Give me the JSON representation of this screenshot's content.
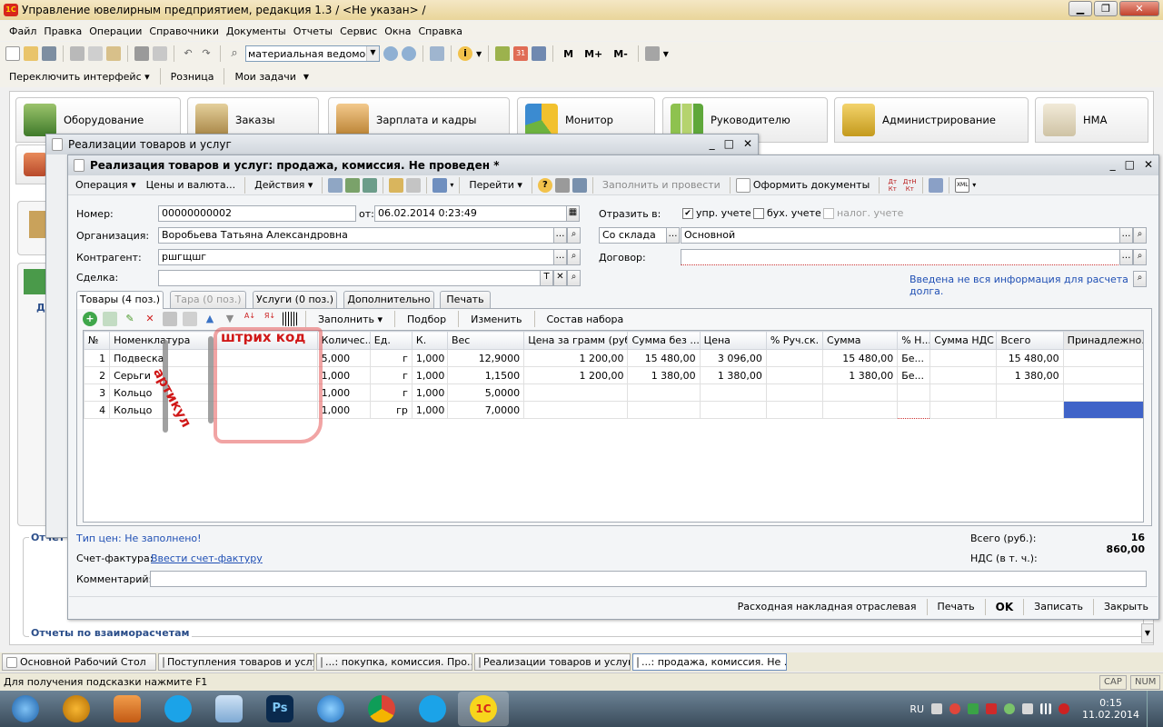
{
  "app": {
    "title": "Управление ювелирным предприятием, редакция 1.3 / <Не указан> /"
  },
  "menu": [
    "Файл",
    "Правка",
    "Операции",
    "Справочники",
    "Документы",
    "Отчеты",
    "Сервис",
    "Окна",
    "Справка"
  ],
  "toolbar": {
    "search_value": "материальная ведомость",
    "m_buttons": [
      "M",
      "M+",
      "M-"
    ]
  },
  "toolbar2": {
    "switch_label": "Переключить интерфейс",
    "retail": "Розница",
    "tasks": "Мои задачи"
  },
  "sections": [
    "Оборудование",
    "Заказы",
    "Зарплата и кадры",
    "Монитор",
    "Руководителю",
    "Администрирование",
    "НМА"
  ],
  "left_labels": {
    "do": "До",
    "otch": "Отчет",
    "reports_mutual": "Отчеты по взаиморасчетам",
    "de": "Де"
  },
  "list_window": {
    "title": "Реализации товаров и услуг"
  },
  "doc": {
    "title": "Реализация товаров и услуг: продажа, комиссия. Не проведен *",
    "toolbar": {
      "operation": "Операция",
      "prices": "Цены и валюта...",
      "actions": "Действия",
      "goto": "Перейти",
      "fill_post": "Заполнить и провести",
      "make_docs": "Оформить документы"
    },
    "number_label": "Номер:",
    "number": "00000000002",
    "from_label": "от:",
    "date": "06.02.2014  0:23:49",
    "reflect_label": "Отразить в:",
    "upr": "упр. учете",
    "buh": "бух. учете",
    "nalog": "налог. учете",
    "org_label": "Организация:",
    "org": "Воробьева Татьяна Александровна",
    "warehouse_type": "Со склада",
    "warehouse": "Основной",
    "contractor_label": "Контрагент:",
    "contractor": "ршгщшг",
    "contract_label": "Договор:",
    "deal_label": "Сделка:",
    "debt_info": "Введена не вся информация для расчета долга.",
    "tabs": [
      "Товары (4 поз.)",
      "Тара (0 поз.)",
      "Услуги (0 поз.)",
      "Дополнительно",
      "Печать"
    ],
    "table_toolbar": {
      "fill": "Заполнить",
      "pick": "Подбор",
      "change": "Изменить",
      "kit": "Состав набора"
    },
    "columns": [
      "№",
      "Номенклатура",
      "Количес...",
      "Ед.",
      "К.",
      "Вес",
      "Цена за грамм (руб.)",
      "Сумма без ...",
      "Цена",
      "% Руч.ск.",
      "Сумма",
      "% Н...",
      "Сумма НДС",
      "Всего",
      "Принадлежно..."
    ],
    "rows": [
      [
        "1",
        "Подвеска",
        "",
        "5,000",
        "г",
        "1,000",
        "12,9000",
        "1 200,00",
        "15 480,00",
        "3 096,00",
        "",
        "15 480,00",
        "Бе...",
        "",
        "15 480,00",
        ""
      ],
      [
        "2",
        "Серьги",
        "",
        "1,000",
        "г",
        "1,000",
        "1,1500",
        "1 200,00",
        "1 380,00",
        "1 380,00",
        "",
        "1 380,00",
        "Бе...",
        "",
        "1 380,00",
        ""
      ],
      [
        "3",
        "Кольцо",
        "",
        "1,000",
        "г",
        "1,000",
        "5,0000",
        "",
        "",
        "",
        "",
        "",
        "",
        "",
        "",
        ""
      ],
      [
        "4",
        "Кольцо",
        "",
        "1,000",
        "гр",
        "1,000",
        "7,0000",
        "",
        "",
        "",
        "",
        "",
        "",
        "",
        "",
        ""
      ]
    ],
    "annotations": {
      "article": "артикул",
      "barcode": "штрих код"
    },
    "price_type": "Тип цен: Не заполнено!",
    "total_label": "Всего (руб.):",
    "total": "16 860,00",
    "vat_label": "НДС (в т. ч.):",
    "invoice_label": "Счет-фактура:",
    "invoice_link": "Ввести счет-фактуру",
    "comment_label": "Комментарий:",
    "bottom_buttons": [
      "Расходная накладная отраслевая",
      "Печать",
      "OK",
      "Записать",
      "Закрыть"
    ]
  },
  "window_tabs": [
    "Основной Рабочий Стол",
    "Поступления товаров и услуг",
    "...: покупка, комиссия. Про...",
    "Реализации товаров и услуг",
    "...: продажа, комиссия. Не ..."
  ],
  "status": {
    "hint": "Для получения подсказки нажмите F1",
    "caps": "CAP",
    "num": "NUM"
  },
  "tray": {
    "lang": "RU",
    "time": "0:15",
    "date": "11.02.2014"
  }
}
